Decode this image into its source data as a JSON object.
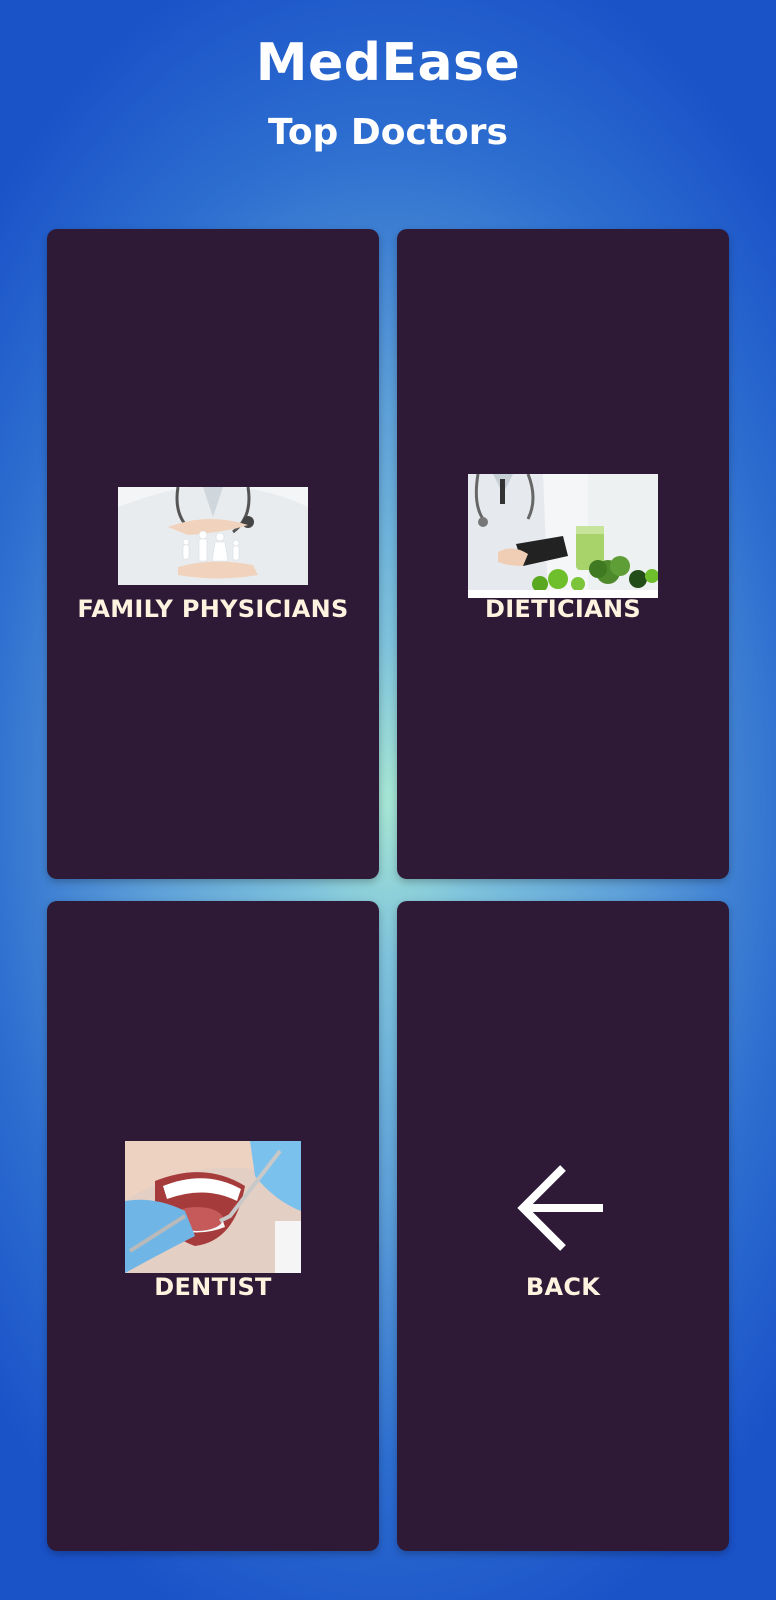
{
  "app": {
    "title": "MedEase",
    "subtitle": "Top Doctors"
  },
  "cards": [
    {
      "label": "FAMILY PHYSICIANS",
      "icon": "family-care-photo"
    },
    {
      "label": "DIETICIANS",
      "icon": "dietician-photo"
    },
    {
      "label": "DENTIST",
      "icon": "dentist-photo"
    },
    {
      "label": "BACK",
      "icon": "arrow-left-icon"
    }
  ],
  "colors": {
    "card_bg": "#2e1a36",
    "label": "#fdf3df",
    "bg_center": "#a6e6d4",
    "bg_edge": "#1a52c8"
  }
}
